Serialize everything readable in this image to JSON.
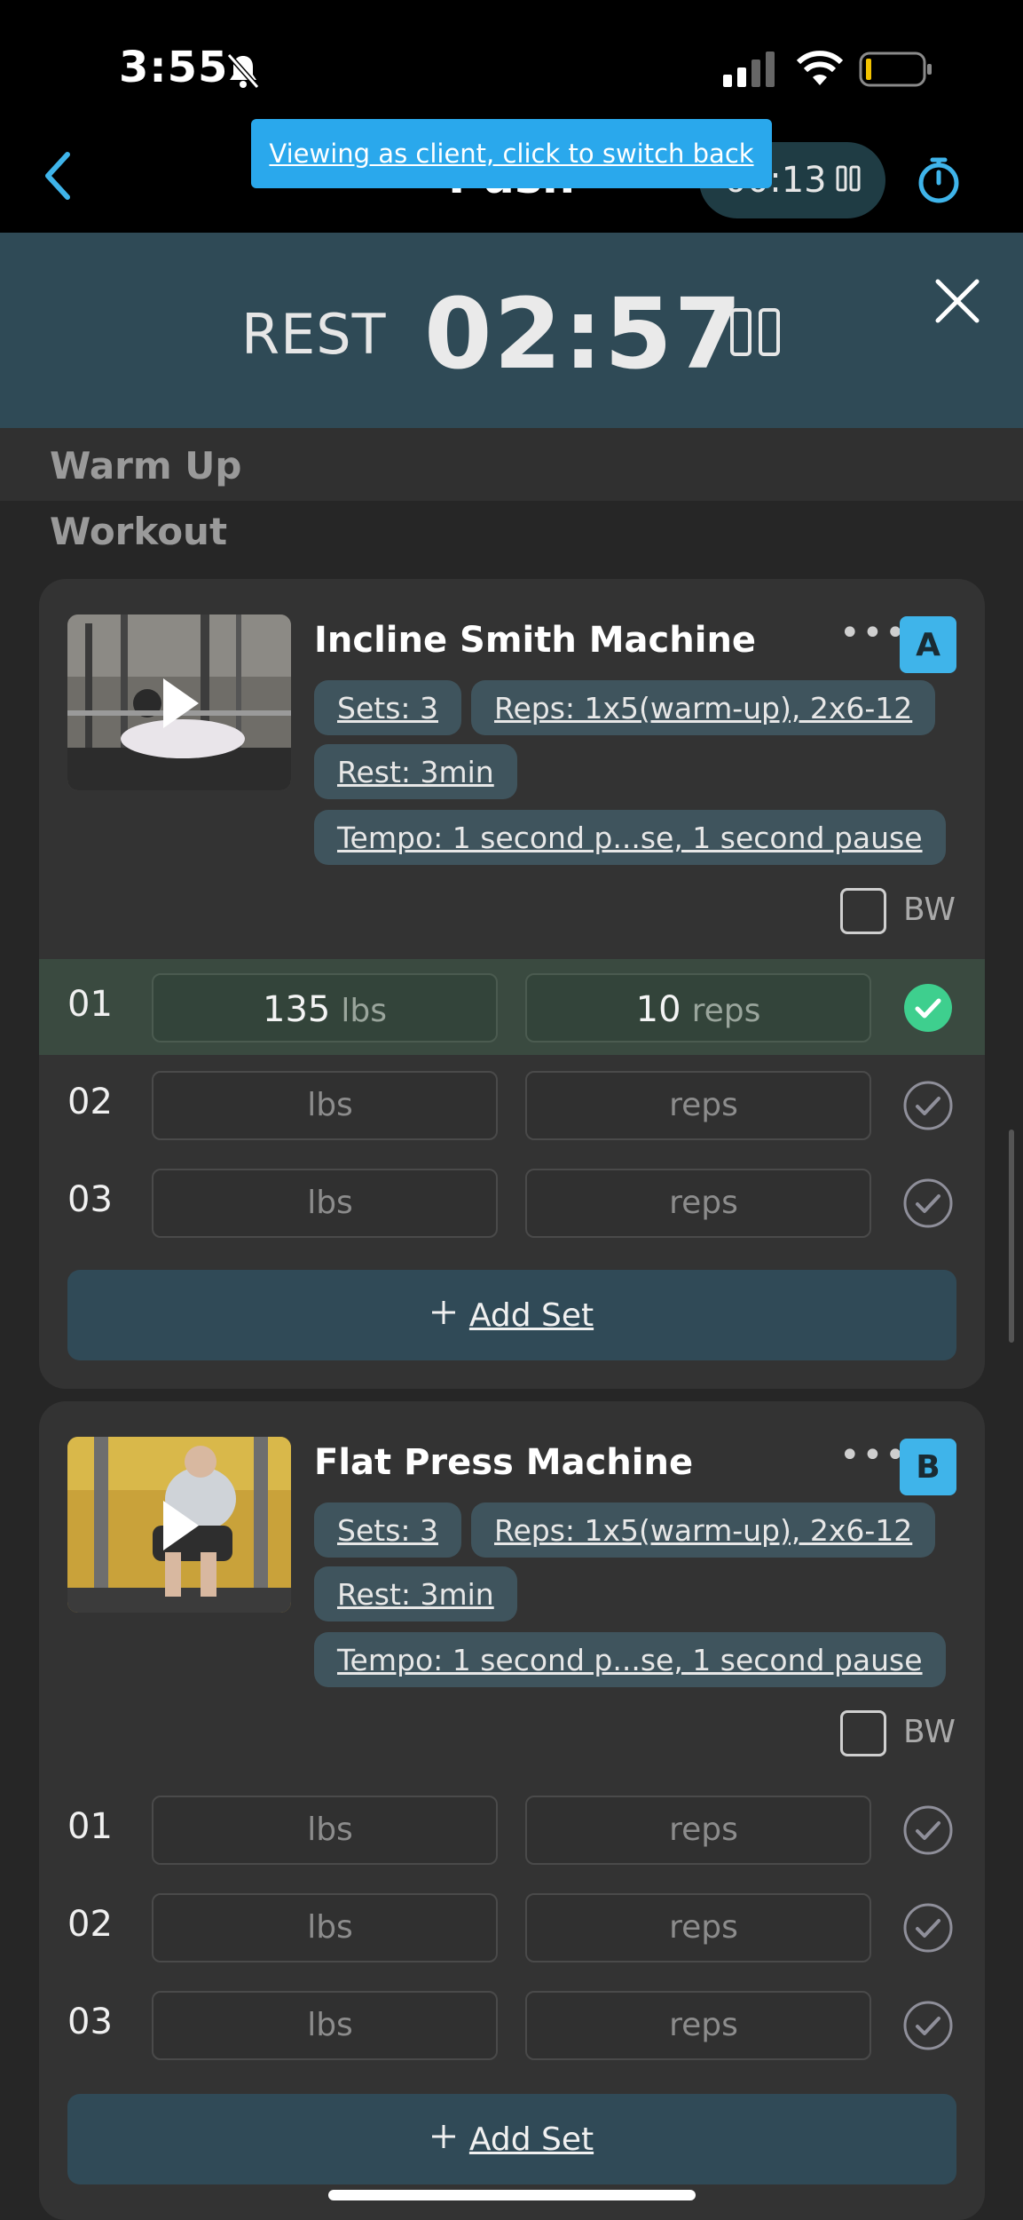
{
  "status_bar": {
    "time": "3:55"
  },
  "header": {
    "title": "Push",
    "timer": "00:13",
    "client_banner": "Viewing as client, click to switch back"
  },
  "rest": {
    "label": "REST",
    "time": "02:57"
  },
  "sections": {
    "warm_up": "Warm Up",
    "workout": "Workout"
  },
  "exercises": [
    {
      "name": "Incline Smith Machine",
      "letter": "A",
      "sets_chip": "Sets: 3",
      "reps_chip": "Reps: 1x5(warm-up), 2x6-12",
      "rest_chip": "Rest: 3min",
      "tempo_chip": "Tempo: 1 second p...se, 1 second pause",
      "bw_label": "BW",
      "sets": [
        {
          "num": "01",
          "weight": "135",
          "weight_unit": "lbs",
          "reps": "10",
          "reps_unit": "reps",
          "done": true
        },
        {
          "num": "02",
          "weight": "",
          "weight_unit": "lbs",
          "reps": "",
          "reps_unit": "reps",
          "done": false
        },
        {
          "num": "03",
          "weight": "",
          "weight_unit": "lbs",
          "reps": "",
          "reps_unit": "reps",
          "done": false
        }
      ],
      "add_set_label": "Add Set"
    },
    {
      "name": "Flat Press Machine",
      "letter": "B",
      "sets_chip": "Sets: 3",
      "reps_chip": "Reps: 1x5(warm-up), 2x6-12",
      "rest_chip": "Rest: 3min",
      "tempo_chip": "Tempo: 1 second p...se, 1 second pause",
      "bw_label": "BW",
      "sets": [
        {
          "num": "01",
          "weight": "",
          "weight_unit": "lbs",
          "reps": "",
          "reps_unit": "reps",
          "done": false
        },
        {
          "num": "02",
          "weight": "",
          "weight_unit": "lbs",
          "reps": "",
          "reps_unit": "reps",
          "done": false
        },
        {
          "num": "03",
          "weight": "",
          "weight_unit": "lbs",
          "reps": "",
          "reps_unit": "reps",
          "done": false
        }
      ],
      "add_set_label": "Add Set"
    }
  ],
  "colors": {
    "accent_blue": "#3fb4ea",
    "rest_bar": "#2f4a56",
    "done_green": "#3ecf8e",
    "add_set_bg": "#304a57"
  }
}
